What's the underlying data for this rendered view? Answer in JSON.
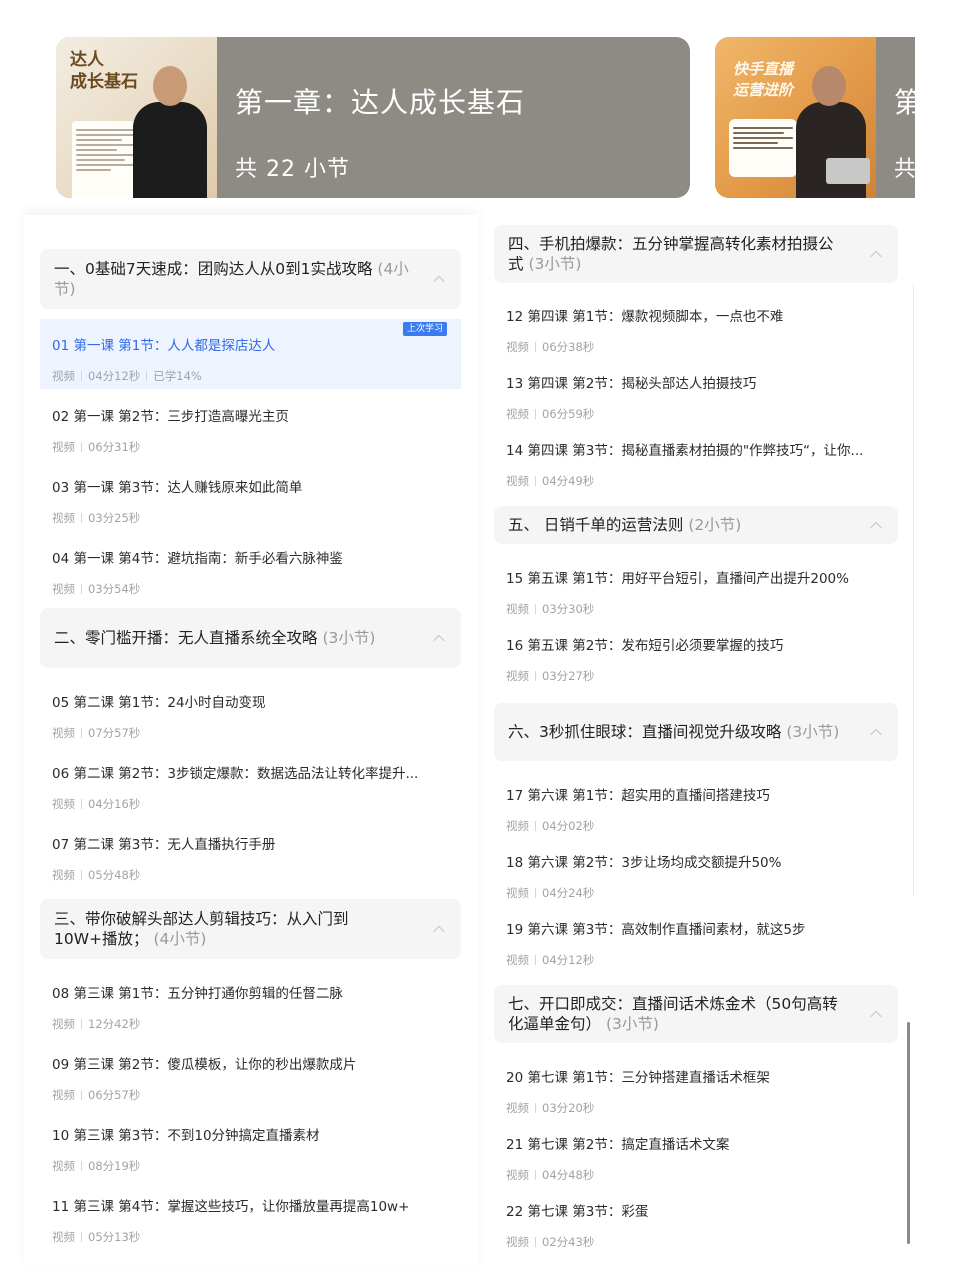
{
  "banners": [
    {
      "thumb_text": "达人\n成长基石",
      "title": "第一章：达人成长基石",
      "subtitle": "共 22 小节"
    },
    {
      "thumb_text": "快手直播\n运营进阶",
      "title": "第",
      "subtitle": "共"
    }
  ],
  "left_column": {
    "sections": [
      {
        "title": "一、0基础7天速成：团购达人从0到1实战攻略",
        "count": "(4小节)",
        "items": [
          {
            "title": "01 第一课 第1节：人人都是探店达人",
            "type": "视频",
            "duration": "04分12秒",
            "progress": "已学14%",
            "badge": "上次学习",
            "active": true
          },
          {
            "title": "02 第一课 第2节：三步打造高曝光主页",
            "type": "视频",
            "duration": "06分31秒"
          },
          {
            "title": "03 第一课 第3节：达人赚钱原来如此简单",
            "type": "视频",
            "duration": "03分25秒"
          },
          {
            "title": "04 第一课 第4节：避坑指南：新手必看六脉神鉴",
            "type": "视频",
            "duration": "03分54秒"
          }
        ]
      },
      {
        "title": "二、零门槛开播：无人直播系统全攻略",
        "count": "(3小节)",
        "items": [
          {
            "title": "05 第二课 第1节：24小时自动变现",
            "type": "视频",
            "duration": "07分57秒"
          },
          {
            "title": "06 第二课 第2节：3步锁定爆款：数据选品法让转化率提升...",
            "type": "视频",
            "duration": "04分16秒"
          },
          {
            "title": "07 第二课 第3节：无人直播执行手册",
            "type": "视频",
            "duration": "05分48秒"
          }
        ]
      },
      {
        "title": "三、带你破解头部达人剪辑技巧：从入门到10W+播放；",
        "count": "(4小节)",
        "items": [
          {
            "title": "08 第三课 第1节：五分钟打通你剪辑的任督二脉",
            "type": "视频",
            "duration": "12分42秒"
          },
          {
            "title": "09 第三课 第2节：傻瓜模板，让你的秒出爆款成片",
            "type": "视频",
            "duration": "06分57秒"
          },
          {
            "title": "10 第三课 第3节：不到10分钟搞定直播素材",
            "type": "视频",
            "duration": "08分19秒"
          },
          {
            "title": "11 第三课 第4节：掌握这些技巧，让你播放量再提高10w+",
            "type": "视频",
            "duration": "05分13秒"
          }
        ]
      }
    ]
  },
  "right_column": {
    "sections": [
      {
        "title": "四、手机拍爆款：五分钟掌握高转化素材拍摄公式",
        "count": "(3小节)",
        "items": [
          {
            "title": "12 第四课 第1节：爆款视频脚本，一点也不难",
            "type": "视频",
            "duration": "06分38秒"
          },
          {
            "title": "13 第四课 第2节：揭秘头部达人拍摄技巧",
            "type": "视频",
            "duration": "06分59秒"
          },
          {
            "title": "14 第四课 第3节：揭秘直播素材拍摄的\"作弊技巧“，让你...",
            "type": "视频",
            "duration": "04分49秒"
          }
        ]
      },
      {
        "title": "五、 日销千单的运营法则",
        "count": "(2小节)",
        "items": [
          {
            "title": "15 第五课 第1节：用好平台短引，直播间产出提升200%",
            "type": "视频",
            "duration": "03分30秒"
          },
          {
            "title": "16 第五课 第2节：发布短引必须要掌握的技巧",
            "type": "视频",
            "duration": "03分27秒"
          }
        ]
      },
      {
        "title": "六、3秒抓住眼球：直播间视觉升级攻略",
        "count": "(3小节)",
        "items": [
          {
            "title": "17 第六课 第1节：超实用的直播间搭建技巧",
            "type": "视频",
            "duration": "04分02秒"
          },
          {
            "title": "18 第六课 第2节：3步让场均成交额提升50%",
            "type": "视频",
            "duration": "04分24秒"
          },
          {
            "title": "19 第六课 第3节：高效制作直播间素材，就这5步",
            "type": "视频",
            "duration": "04分12秒"
          }
        ]
      },
      {
        "title": "七、开口即成交：直播间话术炼金术（50句高转化逼单金句）",
        "count": "(3小节)",
        "items": [
          {
            "title": "20 第七课 第1节：三分钟搭建直播话术框架",
            "type": "视频",
            "duration": "03分20秒"
          },
          {
            "title": "21 第七课 第2节：搞定直播话术文案",
            "type": "视频",
            "duration": "04分48秒"
          },
          {
            "title": "22 第七课 第3节：彩蛋",
            "type": "视频",
            "duration": "02分43秒"
          }
        ]
      }
    ]
  }
}
